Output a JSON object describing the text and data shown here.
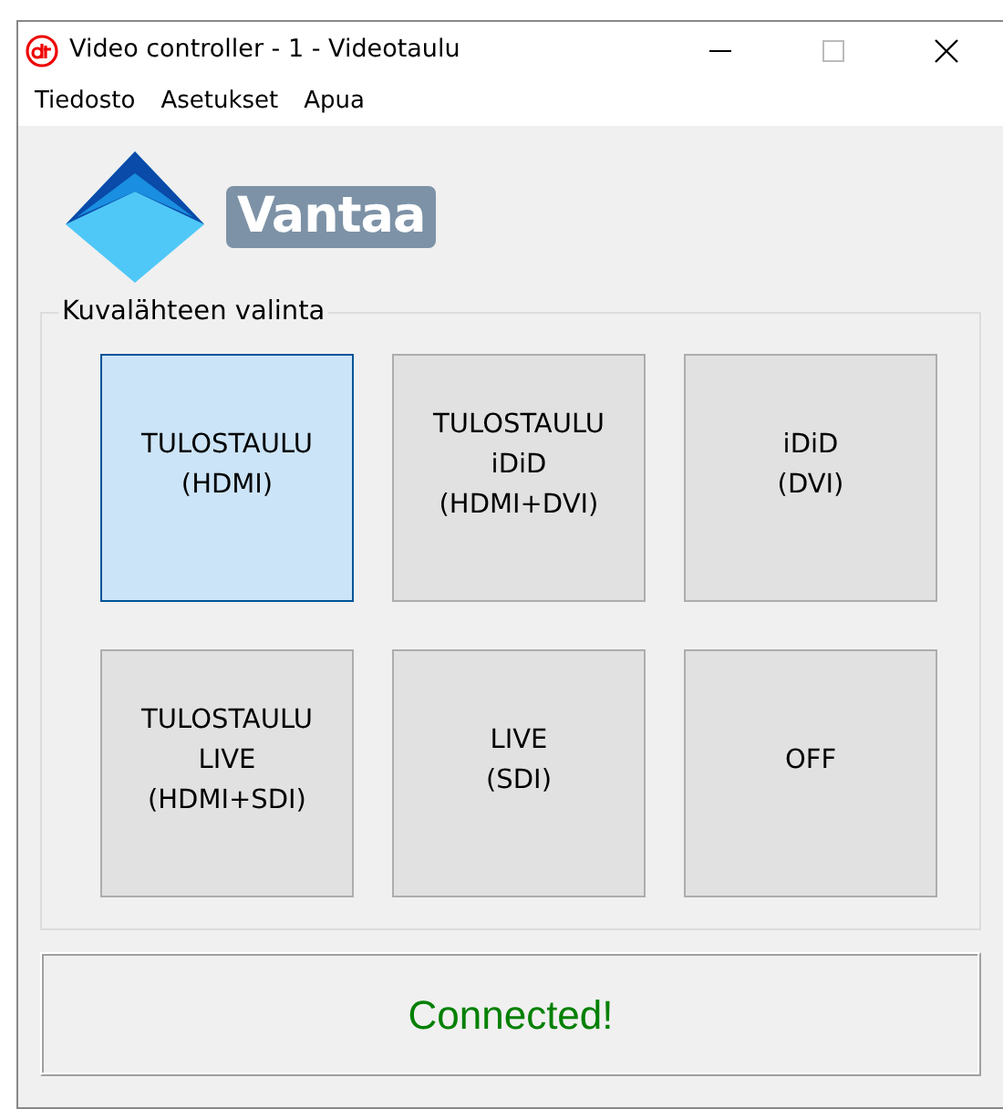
{
  "window": {
    "title": "Video controller - 1 - Videotaulu"
  },
  "menu": [
    "Tiedosto",
    "Asetukset",
    "Apua"
  ],
  "logo": {
    "text": "Vantaa"
  },
  "source_group": {
    "title": "Kuvalähteen valinta",
    "buttons": [
      {
        "lines": [
          "TULOSTAULU",
          "(HDMI)"
        ],
        "selected": true
      },
      {
        "lines": [
          "TULOSTAULU",
          "iDiD",
          "(HDMI+DVI)"
        ],
        "selected": false
      },
      {
        "lines": [
          "iDiD",
          "(DVI)"
        ],
        "selected": false
      },
      {
        "lines": [
          "TULOSTAULU",
          "LIVE",
          "(HDMI+SDI)"
        ],
        "selected": false
      },
      {
        "lines": [
          "LIVE",
          "(SDI)"
        ],
        "selected": false
      },
      {
        "lines": [
          "OFF"
        ],
        "selected": false
      }
    ]
  },
  "status": {
    "text": "Connected!",
    "color": "#008000"
  }
}
